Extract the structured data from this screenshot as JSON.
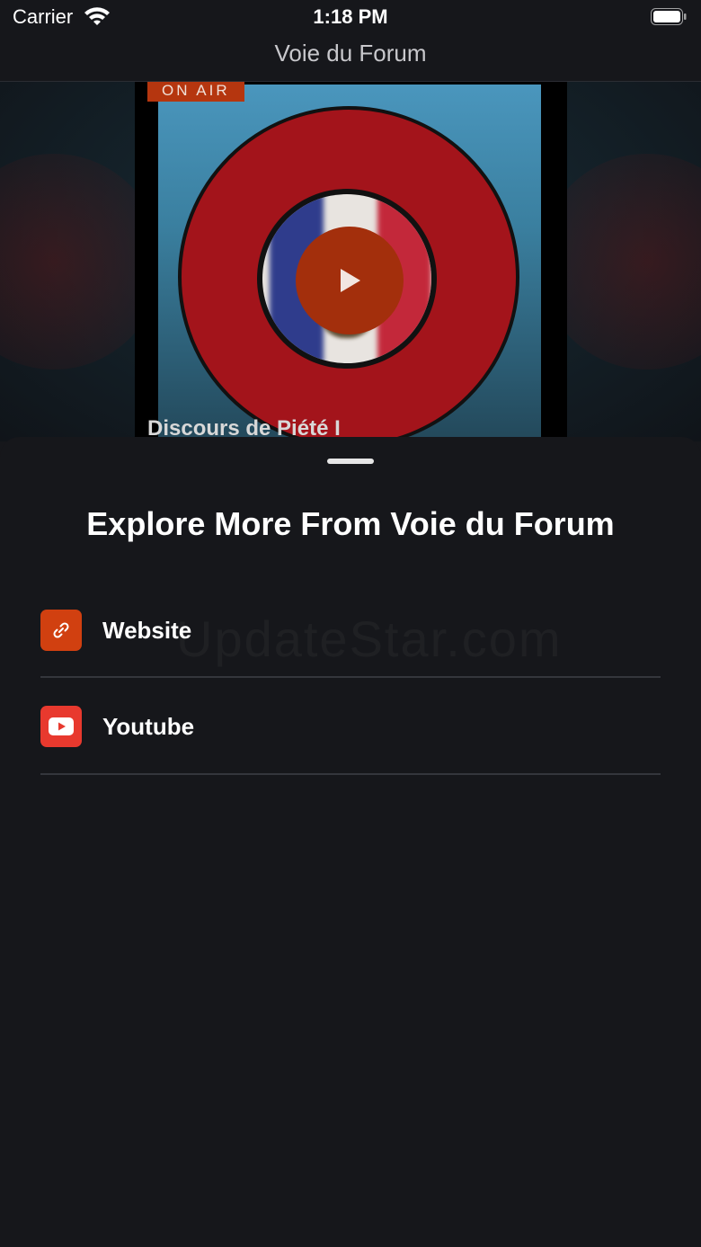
{
  "status_bar": {
    "carrier": "Carrier",
    "time": "1:18 PM"
  },
  "nav": {
    "title": "Voie du Forum"
  },
  "player": {
    "badge": "ON AIR",
    "track_title": "Discours de Piété I"
  },
  "sheet": {
    "title": "Explore More From Voie du Forum",
    "links": [
      {
        "label": "Website",
        "icon": "link-icon",
        "color": "#d14010"
      },
      {
        "label": "Youtube",
        "icon": "youtube-icon",
        "color": "#e8392e"
      }
    ],
    "watermark": "UpdateStar.com"
  }
}
